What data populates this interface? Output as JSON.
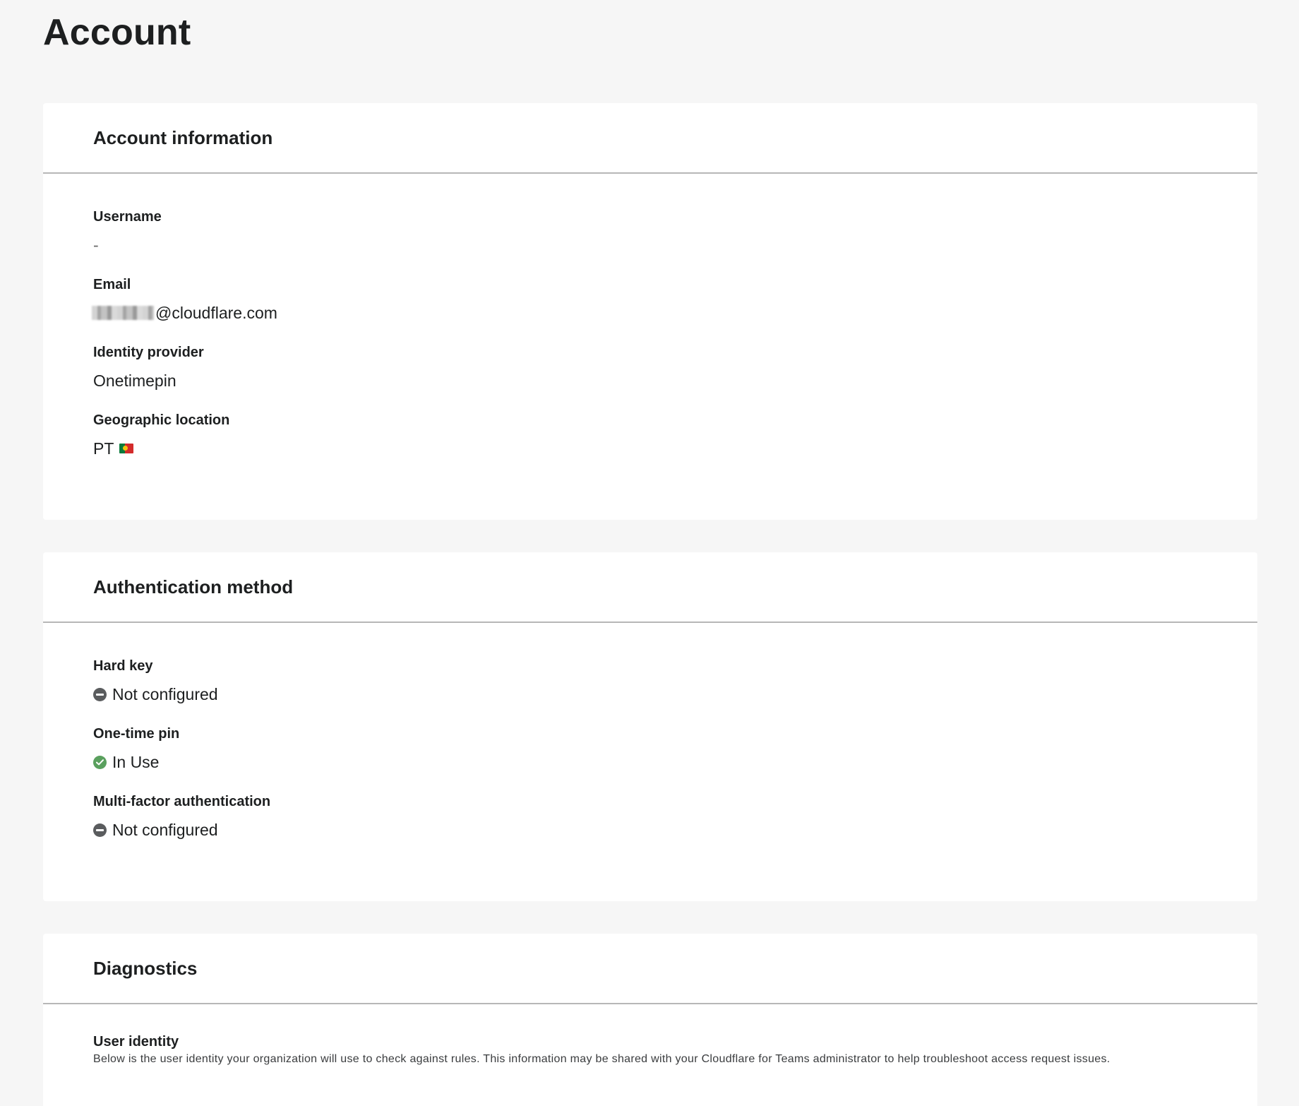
{
  "page": {
    "title": "Account"
  },
  "account_info": {
    "title": "Account information",
    "fields": [
      {
        "label": "Username",
        "value": "-"
      },
      {
        "label": "Email",
        "value": "@cloudflare.com"
      },
      {
        "label": "Identity provider",
        "value": "Onetimepin"
      },
      {
        "label": "Geographic location",
        "value": "PT"
      }
    ]
  },
  "auth_method": {
    "title": "Authentication method",
    "fields": [
      {
        "label": "Hard key",
        "value": "Not configured",
        "status": "neutral"
      },
      {
        "label": "One-time pin",
        "value": "In Use",
        "status": "ok"
      },
      {
        "label": "Multi-factor authentication",
        "value": "Not configured",
        "status": "neutral"
      }
    ]
  },
  "diagnostics": {
    "title": "Diagnostics",
    "user_identity": {
      "label": "User identity",
      "description": "Below is the user identity your organization will use to check against rules. This information may be shared with your Cloudflare for Teams administrator to help troubleshoot access request issues."
    }
  },
  "colors": {
    "background": "#f6f6f6",
    "card": "#ffffff",
    "divider": "#b7b7b7",
    "status_neutral": "#5a5c5e",
    "status_ok": "#5aa05e"
  },
  "icons": {
    "neutral": "minus-circle-icon",
    "ok": "check-circle-icon",
    "flag": "portugal-flag-icon"
  }
}
